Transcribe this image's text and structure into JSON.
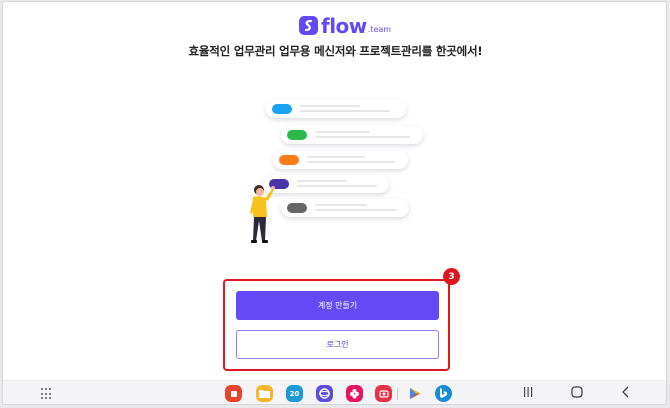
{
  "logo": {
    "name": "flow",
    "suffix": ".team"
  },
  "tagline": "효율적인 업무관리 업무용 메신저와 프로젝트관리를 한곳에서!",
  "buttons": {
    "signup": "계정 만들기",
    "login": "로그인"
  },
  "annotation": {
    "badge": "3"
  },
  "dock": {
    "calendar_date": "20",
    "apps": [
      "flexcil",
      "my-files",
      "calendar",
      "samsung-internet",
      "flower-gallery",
      "screen-recorder",
      "play-store",
      "bing"
    ]
  },
  "colors": {
    "brand": "#6449f5",
    "highlight": "#e0171f",
    "pills": [
      "#1aa3f0",
      "#2cb84a",
      "#ff7a1a",
      "#4a35a8",
      "#666666"
    ]
  }
}
